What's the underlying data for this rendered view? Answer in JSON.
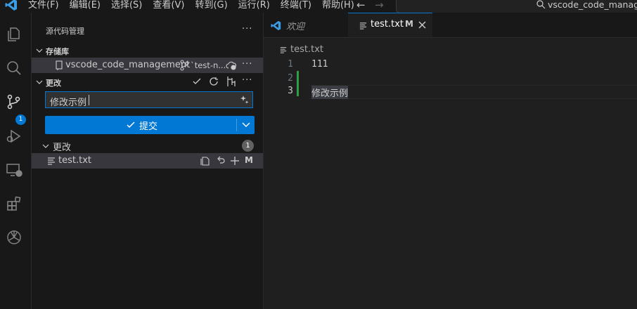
{
  "titlebar": {
    "menus": [
      "文件(F)",
      "编辑(E)",
      "选择(S)",
      "查看(V)",
      "转到(G)",
      "运行(R)",
      "终端(T)",
      "帮助(H)"
    ],
    "command_center_text": "vscode_code_managem"
  },
  "activitybar": {
    "icons": [
      "explorer-icon",
      "search-icon",
      "source-control-icon",
      "run-debug-icon",
      "remote-explorer-icon",
      "extensions-icon",
      "chatgpt-icon"
    ],
    "scm_badge": "1"
  },
  "sidebar": {
    "title": "源代码管理",
    "more": "···",
    "repos_header": "存储库",
    "repo_name": "vscode_code_management",
    "branch": "`test-n...",
    "changes_header": "更改",
    "commit_message": "修改示例",
    "commit_button": "提交",
    "changes_group": "更改",
    "changes_count": "1",
    "file_name": "test.txt",
    "file_status": "M"
  },
  "editor": {
    "tabs": [
      {
        "label": "欢迎"
      },
      {
        "label": "test.txt",
        "status": "M"
      }
    ],
    "breadcrumb": "test.txt",
    "lines": [
      {
        "number": "1",
        "text": "111"
      },
      {
        "number": "2",
        "text": ""
      },
      {
        "number": "3",
        "text": "修改示例"
      }
    ]
  },
  "colors": {
    "accent": "#0078d4",
    "modified_gutter": "#2ea043",
    "badge_gray": "#616161"
  }
}
